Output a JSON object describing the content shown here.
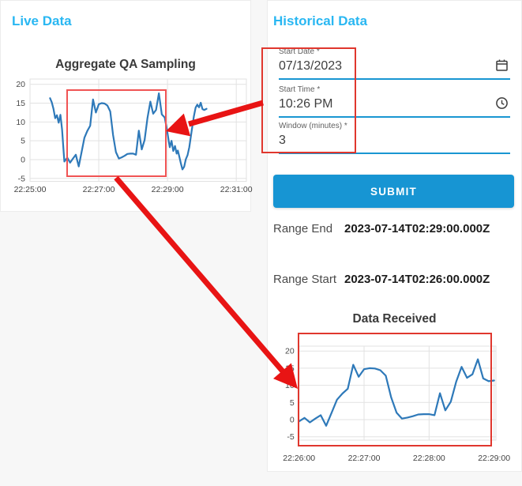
{
  "live_panel": {
    "heading": "Live Data"
  },
  "historical_panel": {
    "heading": "Historical Data",
    "fields": [
      {
        "label": "Start Date",
        "required_mark": "*",
        "value": "07/13/2023",
        "icon": "calendar"
      },
      {
        "label": "Start Time",
        "required_mark": "*",
        "value": "10:26 PM",
        "icon": "clock"
      },
      {
        "label": "Window (minutes)",
        "required_mark": "*",
        "value": "3",
        "icon": "none"
      }
    ],
    "submit_label": "SUBMIT",
    "results": [
      {
        "label": "Range End",
        "value": "2023-07-14T02:29:00.000Z"
      },
      {
        "label": "Range Start",
        "value": "2023-07-14T02:26:00.000Z"
      }
    ]
  },
  "colors": {
    "heading_blue": "#29b7f2",
    "button_blue": "#1795d3",
    "underline_blue": "#1996d2",
    "line_blue": "#2e79b9",
    "annotation_red": "#e81414",
    "grid_gray": "#e2e2e2"
  },
  "chart_data": [
    {
      "type": "line",
      "title": "Aggregate QA Sampling",
      "xlabel": "",
      "ylabel": "",
      "ylim": [
        -5,
        20
      ],
      "y_ticks": [
        20,
        15,
        10,
        5,
        0,
        -5
      ],
      "x_tick_labels": [
        "22:25:00",
        "22:27:00",
        "22:29:00",
        "22:31:00"
      ],
      "x_tick_seconds": [
        0,
        120,
        240,
        360
      ],
      "grid": true,
      "legend": "none",
      "series": [
        {
          "name": "Aggregate QA Sampling",
          "x": [
            35,
            38,
            41,
            44,
            47,
            50,
            53,
            56,
            58,
            60,
            65,
            70,
            75,
            80,
            85,
            90,
            95,
            100,
            105,
            110,
            115,
            120,
            125,
            130,
            135,
            140,
            145,
            150,
            155,
            160,
            165,
            170,
            175,
            180,
            185,
            190,
            195,
            200,
            205,
            210,
            215,
            220,
            225,
            230,
            235,
            239,
            242,
            244,
            247,
            250,
            253,
            256,
            258,
            260,
            263,
            266,
            269,
            272,
            275,
            278,
            282,
            286,
            289,
            292,
            295,
            298,
            301,
            304,
            308
          ],
          "y": [
            16.3,
            15.2,
            13.5,
            11.0,
            11.8,
            9.8,
            11.9,
            8.0,
            3.5,
            -0.5,
            0.5,
            -0.8,
            0.3,
            1.3,
            -1.8,
            2.0,
            5.8,
            7.6,
            9.0,
            16.0,
            12.5,
            14.7,
            15.0,
            14.9,
            14.4,
            12.8,
            6.5,
            2.0,
            0.3,
            0.6,
            1.0,
            1.5,
            1.6,
            1.6,
            1.3,
            7.7,
            2.7,
            5.2,
            11.0,
            15.4,
            12.2,
            13.2,
            17.6,
            12.0,
            11.2,
            8.0,
            5.0,
            3.3,
            5.0,
            2.3,
            3.6,
            1.6,
            2.4,
            1.2,
            -0.8,
            -2.6,
            -1.9,
            0.1,
            1.2,
            3.3,
            7.5,
            11.5,
            13.8,
            14.6,
            13.9,
            15.1,
            13.4,
            13.2,
            13.5
          ]
        }
      ]
    },
    {
      "type": "line",
      "title": "Data Received",
      "xlabel": "",
      "ylabel": "",
      "ylim": [
        -5,
        20
      ],
      "y_ticks": [
        20,
        15,
        10,
        5,
        0,
        -5
      ],
      "x_tick_labels": [
        "22:26:00",
        "22:27:00",
        "22:28:00",
        "22:29:00"
      ],
      "x_tick_seconds": [
        0,
        60,
        120,
        180
      ],
      "grid": true,
      "legend": "none",
      "series": [
        {
          "name": "Data Received",
          "x": [
            0,
            5,
            10,
            15,
            20,
            25,
            30,
            35,
            40,
            45,
            50,
            55,
            60,
            65,
            70,
            75,
            80,
            85,
            90,
            95,
            100,
            105,
            110,
            115,
            120,
            125,
            130,
            135,
            140,
            145,
            150,
            155,
            160,
            165,
            170,
            175,
            180
          ],
          "y": [
            -0.5,
            0.5,
            -0.8,
            0.3,
            1.3,
            -1.8,
            2.0,
            5.8,
            7.6,
            9.0,
            16.0,
            12.5,
            14.7,
            15.0,
            14.9,
            14.4,
            12.8,
            6.5,
            2.0,
            0.3,
            0.6,
            1.0,
            1.5,
            1.6,
            1.6,
            1.3,
            7.7,
            2.7,
            5.2,
            11.0,
            15.4,
            12.2,
            13.2,
            17.6,
            12.0,
            11.2,
            11.4
          ]
        }
      ]
    }
  ],
  "annotations": {
    "boxes": [
      "live-chart-window",
      "form-inputs",
      "data-received-plot"
    ],
    "arrows": [
      "form-to-live-chart",
      "live-window-to-data-received"
    ]
  }
}
